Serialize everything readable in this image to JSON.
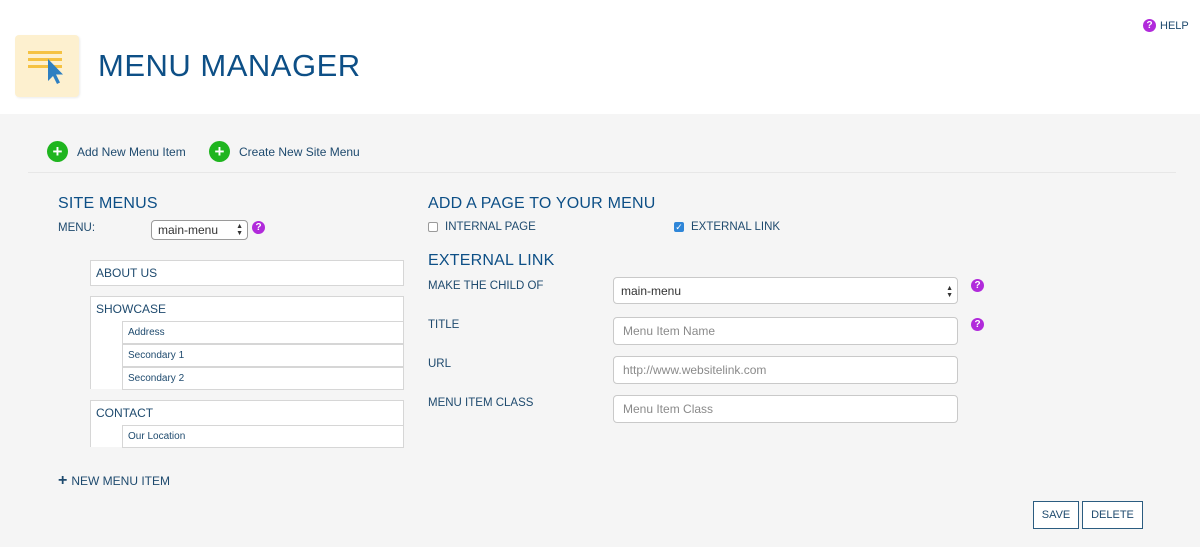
{
  "header": {
    "title": "MENU MANAGER",
    "help_label": "HELP",
    "logo_icon": "menu-cursor-icon"
  },
  "toolbar": {
    "add_item_label": "Add New Menu Item",
    "create_menu_label": "Create New Site Menu"
  },
  "site_menus": {
    "title": "SITE MENUS",
    "menu_label": "MENU:",
    "menu_value": "main-menu",
    "groups": [
      {
        "label": "ABOUT US",
        "children": []
      },
      {
        "label": "SHOWCASE",
        "children": [
          "Address",
          "Secondary 1",
          "Secondary 2"
        ]
      },
      {
        "label": "CONTACT",
        "children": [
          "Our Location"
        ]
      }
    ],
    "new_item_label": "NEW MENU ITEM"
  },
  "add_page": {
    "title": "ADD A PAGE TO YOUR MENU",
    "internal_label": "INTERNAL PAGE",
    "internal_checked": false,
    "external_label": "EXTERNAL LINK",
    "external_checked": true
  },
  "external_link": {
    "title": "EXTERNAL LINK",
    "child_label": "MAKE THE CHILD OF",
    "child_value": "main-menu",
    "title_label": "TITLE",
    "title_placeholder": "Menu Item Name",
    "url_label": "URL",
    "url_placeholder": "http://www.websitelink.com",
    "class_label": "MENU ITEM CLASS",
    "class_placeholder": "Menu Item Class"
  },
  "actions": {
    "save_label": "SAVE",
    "delete_label": "DELETE"
  },
  "colors": {
    "title_blue": "#0d4f86",
    "add_green": "#1fb51f",
    "help_purple": "#b12adb",
    "logo_yellow": "#f5c242",
    "checkbox_blue": "#2f86d8"
  }
}
